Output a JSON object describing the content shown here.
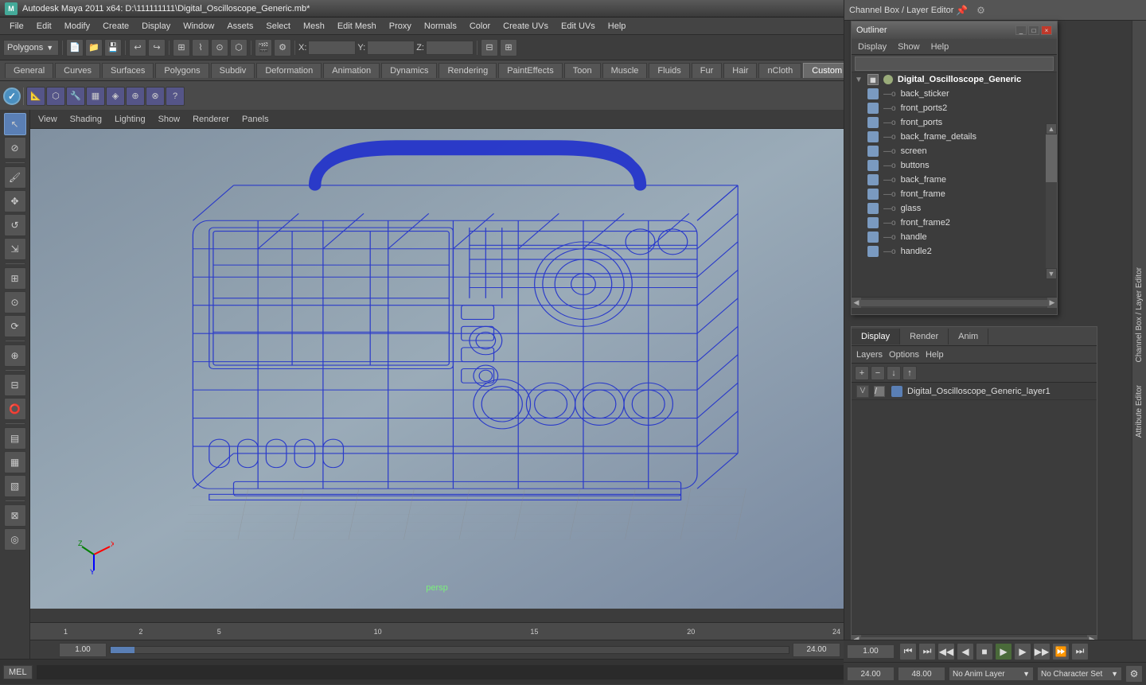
{
  "app": {
    "title": "Autodesk Maya 2011 x64: D:\\111111111\\Digital_Oscilloscope_Generic.mb*",
    "icon": "M"
  },
  "titlebar": {
    "minimize": "_",
    "maximize": "□",
    "close": "✕"
  },
  "menubar": {
    "items": [
      "File",
      "Edit",
      "Modify",
      "Create",
      "Display",
      "Window",
      "Assets",
      "Select",
      "Mesh",
      "Edit Mesh",
      "Proxy",
      "Normals",
      "Color",
      "Create UVs",
      "Edit UVs",
      "Help"
    ]
  },
  "toolbar": {
    "dropdown_label": "Polygons"
  },
  "shelf": {
    "tabs": [
      "General",
      "Curves",
      "Surfaces",
      "Polygons",
      "Subdiv",
      "Deformation",
      "Animation",
      "Dynamics",
      "Rendering",
      "PaintEffects",
      "Toon",
      "Muscle",
      "Fluids",
      "Fur",
      "Hair",
      "nCloth",
      "Custom"
    ]
  },
  "viewport": {
    "menus": [
      "View",
      "Shading",
      "Lighting",
      "Show",
      "Renderer",
      "Panels"
    ],
    "overlay_text": "persp"
  },
  "outliner": {
    "title": "Outliner",
    "menus": [
      "Display",
      "Show",
      "Help"
    ],
    "items": [
      {
        "name": "Digital_Oscilloscope_Generic",
        "type": "root",
        "indent": 0
      },
      {
        "name": "back_sticker",
        "type": "mesh",
        "indent": 1
      },
      {
        "name": "front_ports2",
        "type": "mesh",
        "indent": 1
      },
      {
        "name": "front_ports",
        "type": "mesh",
        "indent": 1
      },
      {
        "name": "back_frame_details",
        "type": "mesh",
        "indent": 1
      },
      {
        "name": "screen",
        "type": "mesh",
        "indent": 1
      },
      {
        "name": "buttons",
        "type": "mesh",
        "indent": 1
      },
      {
        "name": "back_frame",
        "type": "mesh",
        "indent": 1
      },
      {
        "name": "front_frame",
        "type": "mesh",
        "indent": 1
      },
      {
        "name": "glass",
        "type": "mesh",
        "indent": 1
      },
      {
        "name": "front_frame2",
        "type": "mesh",
        "indent": 1
      },
      {
        "name": "handle",
        "type": "mesh",
        "indent": 1
      },
      {
        "name": "handle2",
        "type": "mesh",
        "indent": 1
      }
    ]
  },
  "layer_editor": {
    "tabs": [
      "Display",
      "Render",
      "Anim"
    ],
    "active_tab": "Display",
    "menu_items": [
      "Layers",
      "Options",
      "Help"
    ],
    "layers": [
      {
        "v": "V",
        "name": "Digital_Oscilloscope_Generic_layer1",
        "color": "#5a7fb5"
      }
    ]
  },
  "channel_box": {
    "title": "Channel Box / Layer Editor"
  },
  "attribute_editor": {
    "label": "Attribute Editor"
  },
  "timeline": {
    "start": "1",
    "end": "24",
    "numbers": [
      "1",
      "",
      "",
      "",
      "",
      "",
      "5",
      "",
      "",
      "",
      "",
      "10",
      "",
      "",
      "",
      "",
      "15",
      "",
      "",
      "",
      "",
      "20",
      "",
      "",
      "24"
    ]
  },
  "time_range": {
    "start_frame": "1.00",
    "end_frame": "24.00",
    "anim_end": "48.00",
    "no_anim_layer": "No Anim Layer",
    "no_char_set": "No Character Set"
  },
  "anim_controls": {
    "current_frame": "1.00",
    "buttons": [
      "⏮",
      "⏭",
      "◀◀",
      "◀",
      "■",
      "▶",
      "▶▶",
      "⏩",
      "⏭"
    ]
  },
  "status_bar": {
    "mel_label": "MEL",
    "script_input": ""
  }
}
